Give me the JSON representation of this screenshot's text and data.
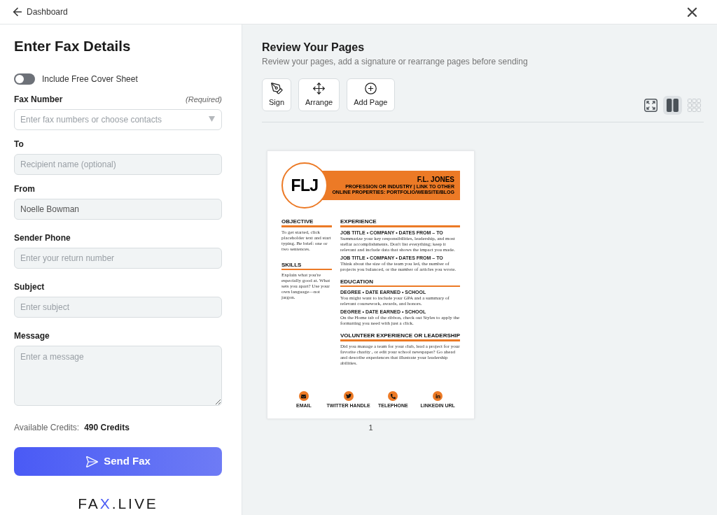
{
  "top_bar": {
    "back_label": "Dashboard"
  },
  "form": {
    "title": "Enter Fax Details",
    "cover_sheet": {
      "label": "Include Free Cover Sheet",
      "on": false
    },
    "fields": [
      {
        "kind": "select",
        "label": "Fax Number",
        "note": "(Required)",
        "placeholder": "Enter fax numbers or choose contacts"
      },
      {
        "kind": "text",
        "label": "To",
        "placeholder": "Recipient name (optional)"
      },
      {
        "kind": "text",
        "label": "From",
        "value": "Noelle Bowman"
      },
      {
        "kind": "text",
        "label": "Sender Phone",
        "placeholder": "Enter your return number"
      },
      {
        "kind": "text",
        "label": "Subject",
        "placeholder": "Enter subject"
      },
      {
        "kind": "textarea",
        "label": "Message",
        "placeholder": "Enter a message"
      }
    ],
    "credits": {
      "label": "Available Credits:",
      "value": "490 Credits"
    },
    "send_button": "Send Fax",
    "logo": {
      "parts": [
        {
          "text": "FA",
          "accent": false
        },
        {
          "text": "X",
          "accent": true
        },
        {
          "text": ".LIVE",
          "accent": false
        }
      ]
    }
  },
  "review": {
    "title": "Review Your Pages",
    "subtitle": "Review your pages, add a signature or rearrange pages before sending",
    "tools": [
      {
        "kind": "sign",
        "label": "Sign"
      },
      {
        "kind": "arrange",
        "label": "Arrange"
      },
      {
        "kind": "add_page",
        "label": "Add Page"
      }
    ],
    "view_controls": [
      {
        "kind": "fit",
        "selected": false,
        "disabled": false
      },
      {
        "kind": "columns",
        "selected": true,
        "disabled": false
      },
      {
        "kind": "grid",
        "selected": false,
        "disabled": true
      }
    ],
    "pages": [
      {
        "number": "1",
        "document": {
          "monogram": "FLJ",
          "name": "F.L. JONES",
          "tagline": "PROFESSION OR INDUSTRY | LINK TO OTHER ONLINE PROPERTIES: PORTFOLIO/WEBSITE/BLOG",
          "left_sections": [
            {
              "heading": "OBJECTIVE",
              "body": "To get started, click placeholder text and start typing. Be brief: one or two sentences."
            },
            {
              "heading": "SKILLS",
              "body": "Explain what you're especially good at. What sets you apart? Use your own language—not jargon."
            }
          ],
          "right_sections": [
            {
              "heading": "EXPERIENCE",
              "entries": [
                {
                  "title": "JOB TITLE • COMPANY • DATES FROM – TO",
                  "body": "Summarize your key responsibilities, leadership, and most stellar accomplishments. Don't list everything; keep it relevant and include data that shows the impact you made."
                },
                {
                  "title": "JOB TITLE • COMPANY • DATES FROM – TO",
                  "body": "Think about the size of the team you led, the number of projects you balanced, or the number of articles you wrote."
                }
              ]
            },
            {
              "heading": "EDUCATION",
              "entries": [
                {
                  "title": "DEGREE • DATE EARNED • SCHOOL",
                  "body": "You might want to include your GPA and a summary of relevant coursework, awards, and honors."
                },
                {
                  "title": "DEGREE • DATE EARNED • SCHOOL",
                  "body": "On the Home tab of the ribbon, check out Styles to apply the formatting you need with just a click."
                }
              ]
            },
            {
              "heading": "VOLUNTEER EXPERIENCE OR LEADERSHIP",
              "body": "Did you manage a team for your club, lead a project for your favorite charity , or edit your school newspaper? Go ahead and describe experiences that illustrate your leadership abilities."
            }
          ],
          "contacts": [
            {
              "kind": "email",
              "label": "EMAIL"
            },
            {
              "kind": "twitter",
              "label": "TWITTER HANDLE"
            },
            {
              "kind": "phone",
              "label": "TELEPHONE"
            },
            {
              "kind": "linkedin",
              "label": "LINKEDIN URL"
            }
          ]
        }
      }
    ]
  }
}
